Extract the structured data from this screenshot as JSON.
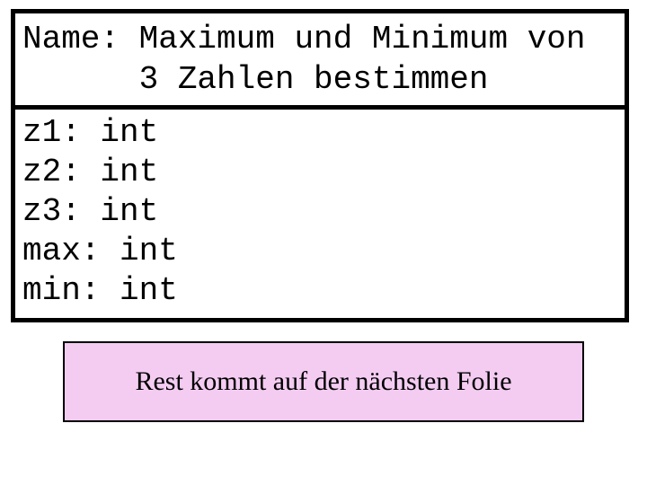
{
  "header": {
    "title_line1": "Name: Maximum und Minimum von",
    "title_line2": "      3 Zahlen bestimmen"
  },
  "vars": {
    "line1": "z1: int",
    "line2": "z2: int",
    "line3": "z3: int",
    "line4": "max: int",
    "line5": "min: int"
  },
  "note": {
    "text": "Rest kommt auf der nächsten Folie"
  }
}
